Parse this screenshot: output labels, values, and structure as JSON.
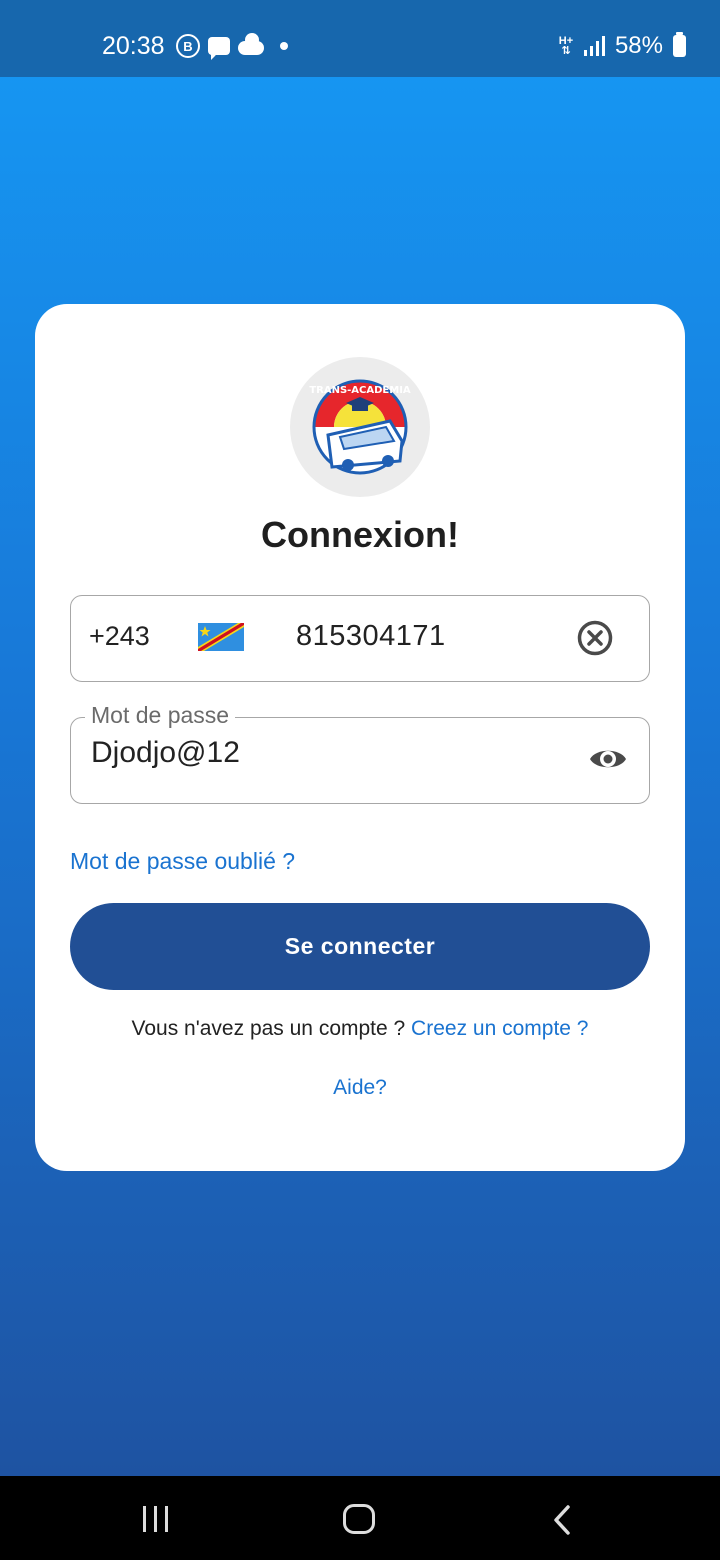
{
  "status_bar": {
    "time": "20:38",
    "battery": "58%",
    "network": "H+",
    "icons": [
      "b-badge-icon",
      "message-icon",
      "cloud-icon",
      "notification-dot-icon",
      "data-transfer-icon",
      "signal-icon",
      "battery-icon"
    ]
  },
  "login": {
    "logo_text": "TRANS-ACADEMIA",
    "title": "Connexion!",
    "phone": {
      "dial_code": "+243",
      "country_flag": "DR Congo flag",
      "number": "815304171"
    },
    "password": {
      "label": "Mot de passe",
      "value": "Djodjo@12"
    },
    "forgot_password": "Mot de passe oublié ?",
    "login_button": "Se connecter",
    "no_account_text": "Vous n'avez pas un compte ?",
    "create_account_link": "Creez un compte ?",
    "help_link": "Aide?"
  },
  "colors": {
    "primary_button": "#214f95",
    "link": "#1a73d0",
    "background_top": "#1699f5",
    "background_bottom": "#1f4f9c",
    "status_bar": "#1767ad"
  },
  "nav_bar": {
    "icons": [
      "recent-apps-icon",
      "home-icon",
      "back-icon"
    ]
  }
}
